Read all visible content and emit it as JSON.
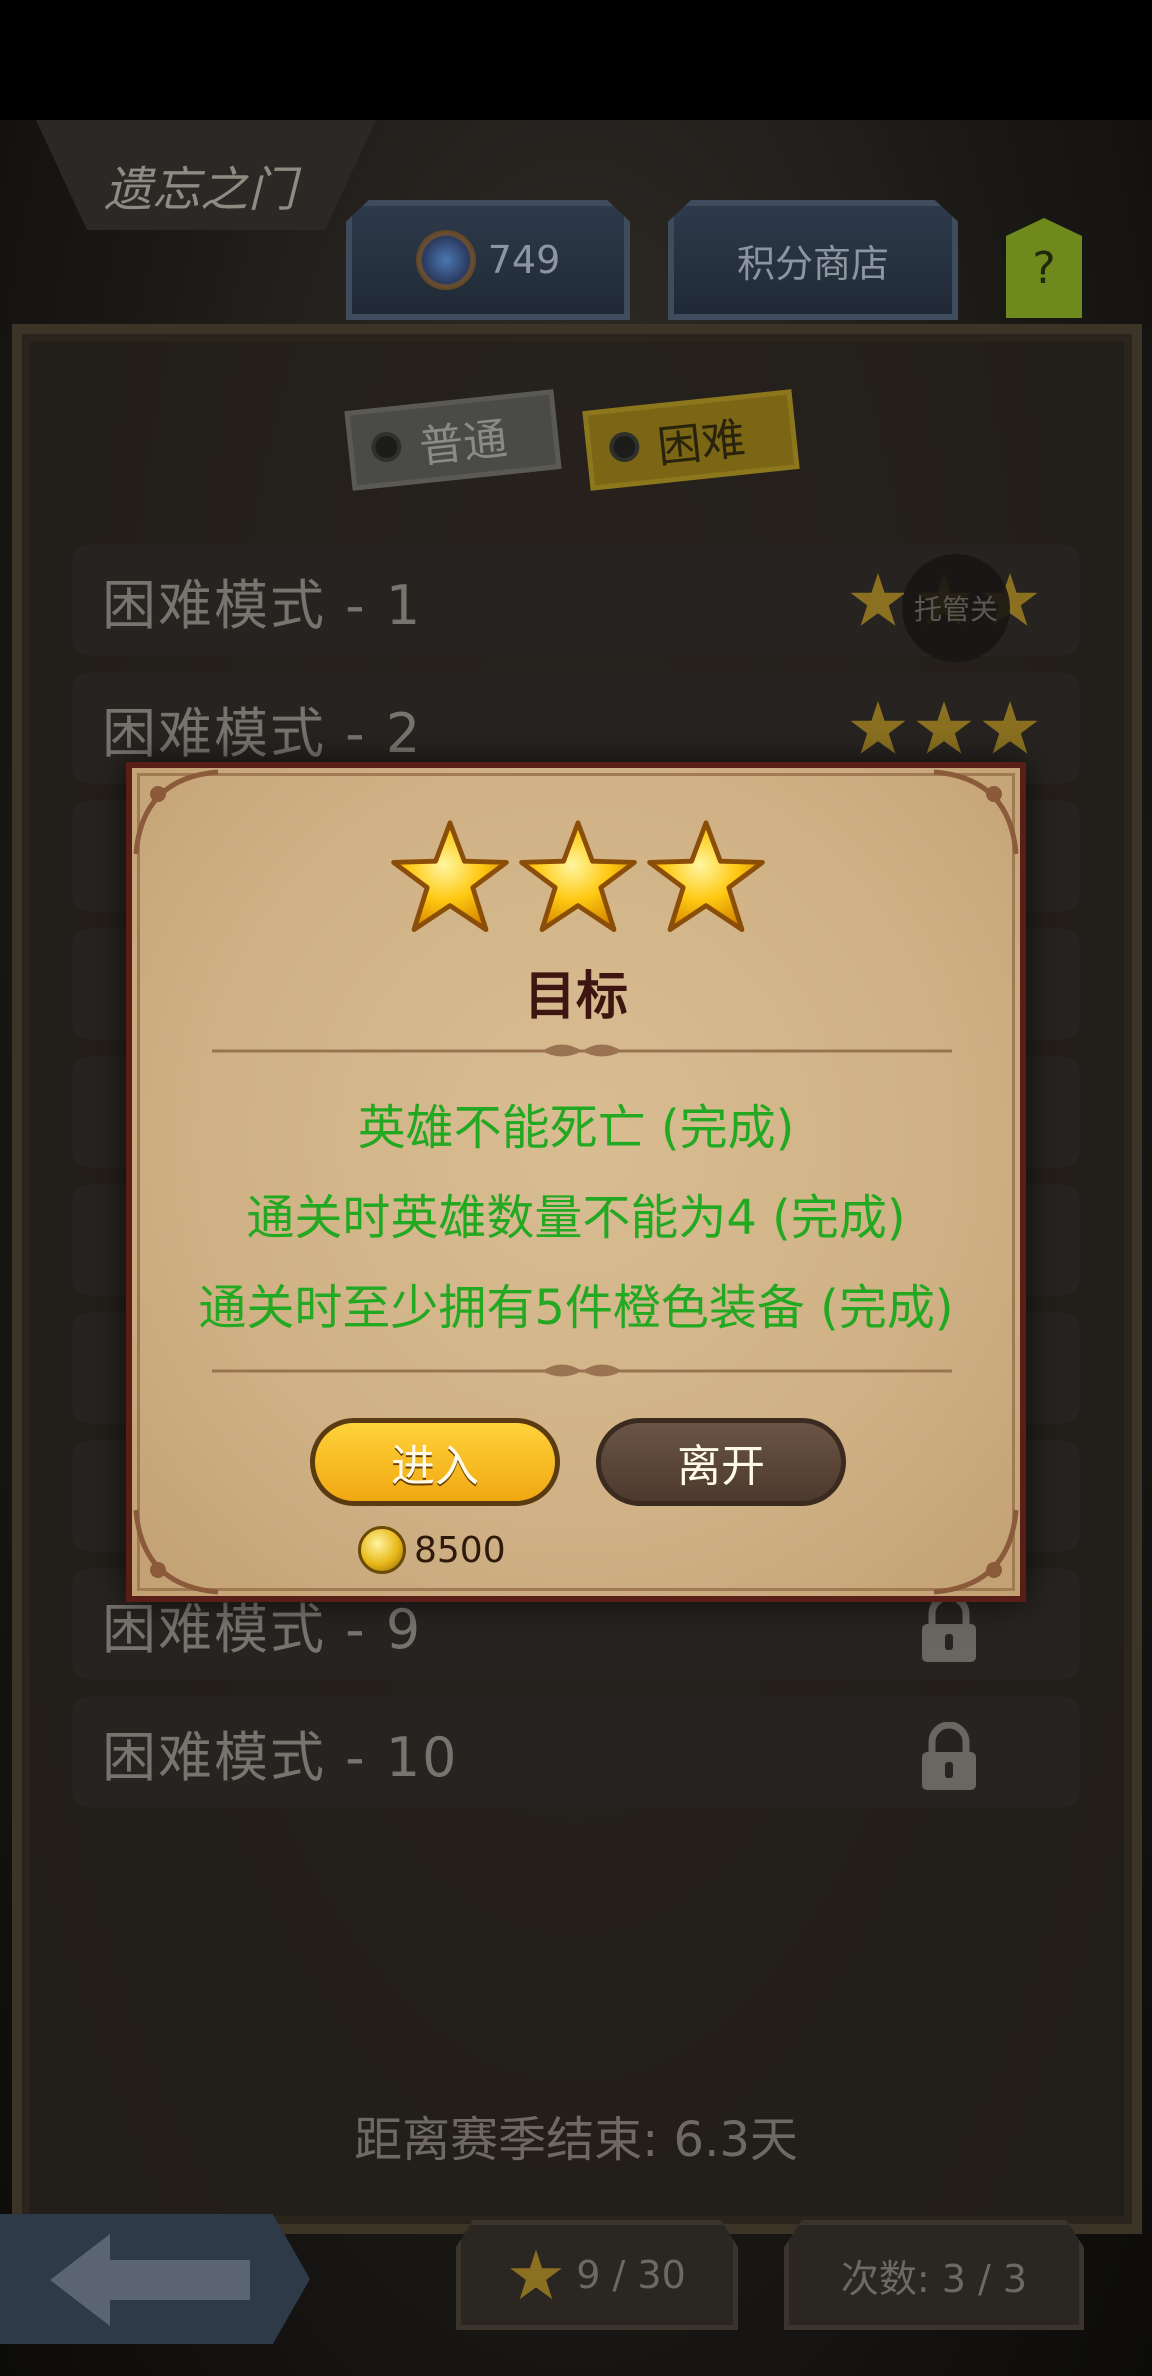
{
  "header": {
    "title": "遗忘之门",
    "currency_value": "749",
    "shop_label": "积分商店",
    "help_label": "?"
  },
  "tabs": {
    "normal_label": "普通",
    "hard_label": "困难",
    "selected": "困难"
  },
  "levels": [
    {
      "label": "困难模式 - 1",
      "stars": 3,
      "badge": "托管关"
    },
    {
      "label": "困难模式 - 2",
      "stars": 3
    },
    {
      "label": "困难模式 - 9",
      "locked": true
    },
    {
      "label": "困难模式 - 10",
      "locked": true
    }
  ],
  "season": {
    "text": "距离赛季结束: 6.3天"
  },
  "footer": {
    "stars_progress": "9 / 30",
    "attempts": "次数: 3 / 3"
  },
  "dialog": {
    "stars_earned": 3,
    "title": "目标",
    "goals": [
      "英雄不能死亡 (完成)",
      "通关时英雄数量不能为4 (完成)",
      "通关时至少拥有5件橙色装备 (完成)"
    ],
    "enter_label": "进入",
    "leave_label": "离开",
    "cost": "8500"
  },
  "colors": {
    "goal_complete": "#23a822",
    "dialog_title": "#3f1512",
    "enter_button": "#f5b51c"
  }
}
